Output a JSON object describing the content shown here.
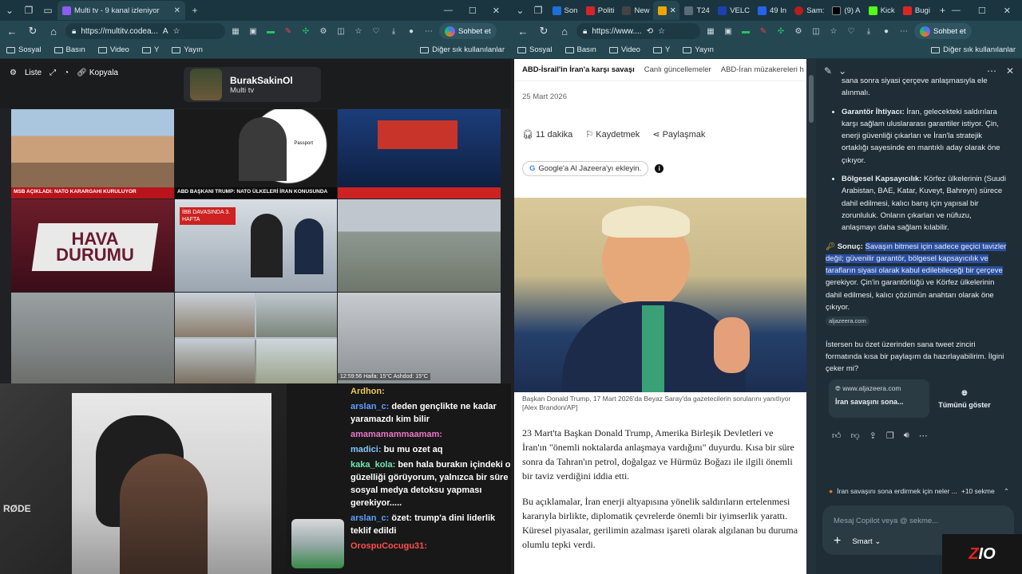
{
  "left_window": {
    "tab_title": "Multi tv - 9 kanal izleniyor",
    "url": "https://multitv.codea...",
    "chat_button": "Sohbet et",
    "bookmarks": [
      "Sosyal",
      "Basın",
      "Video",
      "Y",
      "Yayın"
    ],
    "bookmarks_other": "Diğer sık kullanılanlar"
  },
  "multitv": {
    "tools": [
      "Liste",
      "Kopyala"
    ],
    "channel_name": "BurakSakinOl",
    "channel_sub": "Multi tv",
    "tiles": [
      {
        "banner": "MSB AÇIKLADI: NATO KARARGAHI KURULUYOR"
      },
      {
        "label": "Passport"
      },
      {
        "banner": "ABD BAŞKANI TRUMP: NATO ÜLKELERİ İRAN KONUSUNDA"
      },
      {
        "hava": "HAVA DURUMU"
      },
      {
        "label": "İBB DAVASINDA 3. HAFTA"
      },
      {
        "label": ""
      },
      {
        "label": ""
      },
      {
        "label": ""
      },
      {
        "label": "12:59:56  Haifa: 15°C  Ashdod: 15°C"
      }
    ]
  },
  "chat": [
    {
      "user": "Ardhon:",
      "color": "#e8c85a",
      "text": ""
    },
    {
      "user": "arslan_c:",
      "color": "#5aa0ff",
      "text": "deden gençlikte ne kadar yaramazdı kim bilir"
    },
    {
      "user": "amamamammaamam:",
      "color": "#e879c6",
      "text": ""
    },
    {
      "user": "madici:",
      "color": "#7ec8ff",
      "text": "bu mu ozet aq"
    },
    {
      "user": "kaka_kola:",
      "color": "#6ee7b7",
      "text": "ben hala burakın içindeki o güzelliği görüyorum, yalnızca bir süre sosyal medya detoksu yapması gerekiyor....."
    },
    {
      "user": "arslan_c:",
      "color": "#5aa0ff",
      "text": "özet: trump'a dini liderlik teklif edildi"
    },
    {
      "user": "OrospuCocugu31:",
      "color": "#ff4d4d",
      "text": ""
    }
  ],
  "right_window": {
    "tabs": [
      "Son",
      "Politi",
      "New",
      "",
      "T24",
      "VELC",
      "49 In",
      "Sam:",
      "(9) A",
      "Kick",
      "Bugi"
    ],
    "url": "https://www....",
    "chat_button": "Sohbet et",
    "bookmarks": [
      "Sosyal",
      "Basın",
      "Video",
      "Y",
      "Yayın"
    ],
    "bookmarks_other": "Diğer sık kullanılanlar"
  },
  "article": {
    "nav": [
      "ABD-İsrail'in İran'a karşı savaşı",
      "Canlı güncellemeler",
      "ABD-İran müzakereleri h"
    ],
    "date": "25 Mart 2026",
    "read_time": "11 dakika",
    "save": "Kaydetmek",
    "share": "Paylaşmak",
    "google_btn": "Google'a Al Jazeera'yı ekleyin.",
    "caption": "Başkan Donald Trump, 17 Mart 2026'da Beyaz Saray'da gazetecilerin sorularını yanıtlıyor [Alex Brandon/AP]",
    "paragraphs": [
      "23 Mart'ta Başkan Donald Trump, Amerika Birleşik Devletleri ve İran'ın \"önemli noktalarda anlaşmaya vardığını\" duyurdu. Kısa bir süre sonra da Tahran'ın petrol, doğalgaz ve Hürmüz Boğazı ile ilgili önemli bir taviz verdiğini iddia etti.",
      "Bu açıklamalar, İran enerji altyapısına yönelik saldırıların ertelenmesi kararıyla birlikte, diplomatik çevrelerde önemli bir iyimserlik yarattı. Küresel piyasalar, gerilimin azalması işareti olarak algılanan bu duruma olumlu tepki verdi."
    ]
  },
  "copilot": {
    "top_line": "sana sonra siyasi çerçeve anlaşmasıyla ele alınmalı.",
    "bullets": [
      {
        "title": "Garantör İhtiyacı:",
        "text": "İran, gelecekteki saldırılara karşı sağlam uluslararası garantiler istiyor. Çin, enerji güvenliği çıkarları ve İran'la stratejik ortaklığı sayesinde en mantıklı aday olarak öne çıkıyor."
      },
      {
        "title": "Bölgesel Kapsayıcılık:",
        "text": "Körfez ülkelerinin (Suudi Arabistan, BAE, Katar, Kuveyt, Bahreyn) sürece dahil edilmesi, kalıcı barış için yapısal bir zorunluluk. Onların çıkarları ve nüfuzu, anlaşmayı daha sağlam kılabilir."
      }
    ],
    "sonuc_label": "Sonuç:",
    "sonuc_highlight": "Savaşın bitmesi için sadece geçici tavizler değil; güvenilir garantör, bölgesel kapsayıcılık ve tarafların siyasi olarak kabul edilebileceği bir çerçeve",
    "sonuc_rest": " gerekiyor. Çin'in garantörlüğü ve Körfez ülkelerinin dahil edilmesi, kalıcı çözümün anahtarı olarak öne çıkıyor.",
    "source_chip": "aljazeera.com",
    "followup": "İstersen bu özet üzerinden sana tweet zinciri formatında kısa bir paylaşım da hazırlayabilirim. İlgini çeker mi?",
    "card_site": "www.aljazeera.com",
    "card_title": "İran savaşını sona...",
    "show_all": "Tümünü göster",
    "suggestion": "İran savaşını sona erdirmek için neler ...",
    "suggestion_count": "+10 sekme",
    "input_placeholder": "Mesaj Copilot veya @ sekme...",
    "mode": "Smart"
  },
  "watermark": "ZIO"
}
